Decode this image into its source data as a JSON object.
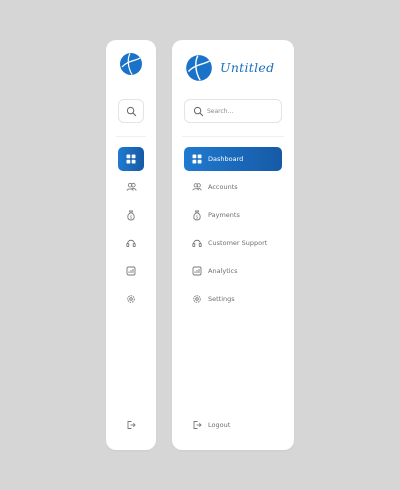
{
  "brand": {
    "name": "Untitled"
  },
  "search": {
    "placeholder": "Search..."
  },
  "nav": {
    "items": [
      {
        "id": "dashboard",
        "label": "Dashboard",
        "icon": "grid-icon",
        "active": true
      },
      {
        "id": "accounts",
        "label": "Accounts",
        "icon": "users-icon",
        "active": false
      },
      {
        "id": "payments",
        "label": "Payments",
        "icon": "money-bag-icon",
        "active": false
      },
      {
        "id": "support",
        "label": "Customer Support",
        "icon": "headset-icon",
        "active": false
      },
      {
        "id": "analytics",
        "label": "Analytics",
        "icon": "chart-icon",
        "active": false
      },
      {
        "id": "settings",
        "label": "Settings",
        "icon": "gear-icon",
        "active": false
      }
    ]
  },
  "logout": {
    "label": "Logout",
    "icon": "logout-icon"
  },
  "colors": {
    "accent": "#1a73c8",
    "accent_dark": "#165aa6",
    "background": "#d6d6d6",
    "panel": "#ffffff",
    "text": "#6f6f6f"
  }
}
